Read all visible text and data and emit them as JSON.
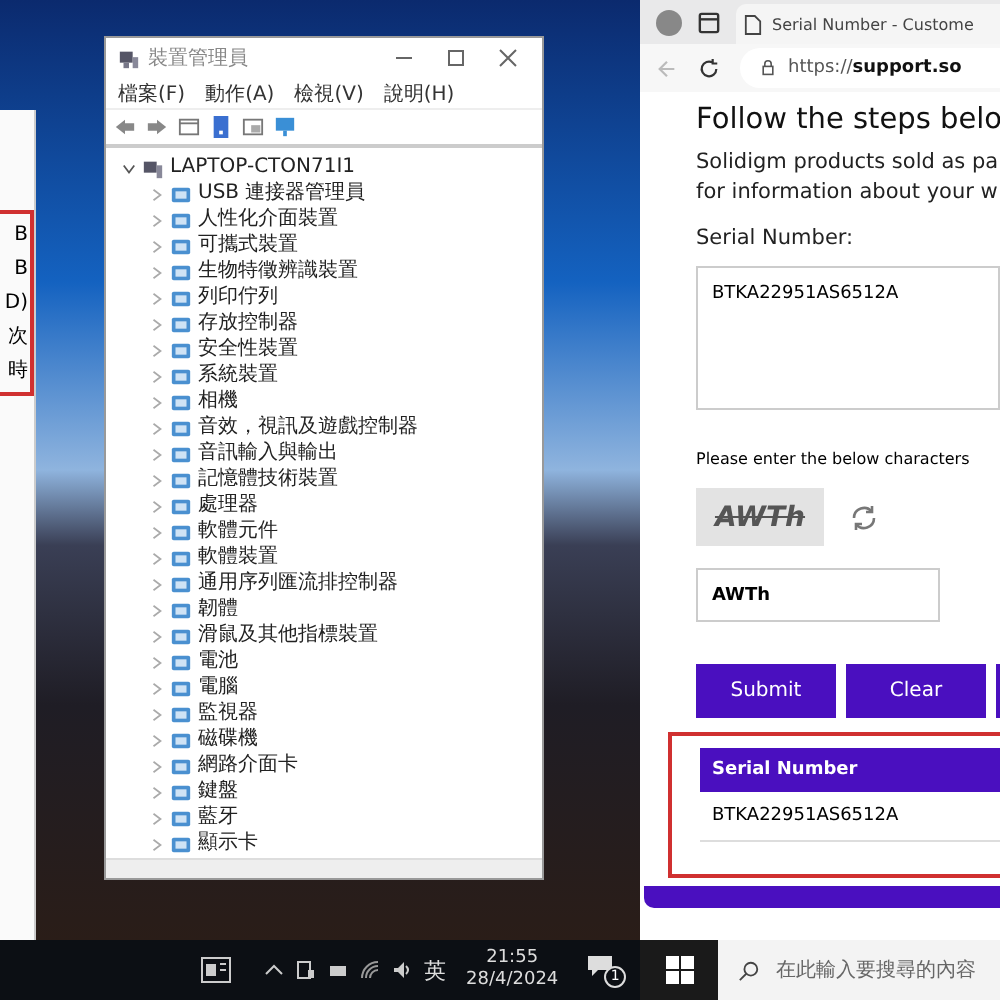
{
  "left_screen": {
    "background_window": {
      "highlighted_values": [
        "B",
        "B",
        "D)",
        "次",
        "時"
      ]
    },
    "device_manager": {
      "title": "裝置管理員",
      "menu": [
        "檔案(F)",
        "動作(A)",
        "檢視(V)",
        "說明(H)"
      ],
      "tree": {
        "label": "LAPTOP-CTON71I1",
        "expanded": true,
        "children": [
          {
            "label": "USB 連接器管理員",
            "expanded": false
          },
          {
            "label": "人性化介面裝置",
            "expanded": false
          },
          {
            "label": "可攜式裝置",
            "expanded": false
          },
          {
            "label": "生物特徵辨識裝置",
            "expanded": false
          },
          {
            "label": "列印佇列",
            "expanded": false
          },
          {
            "label": "存放控制器",
            "expanded": false
          },
          {
            "label": "安全性裝置",
            "expanded": false
          },
          {
            "label": "系統裝置",
            "expanded": false
          },
          {
            "label": "相機",
            "expanded": false
          },
          {
            "label": "音效，視訊及遊戲控制器",
            "expanded": false
          },
          {
            "label": "音訊輸入與輸出",
            "expanded": false
          },
          {
            "label": "記憶體技術裝置",
            "expanded": false
          },
          {
            "label": "處理器",
            "expanded": false
          },
          {
            "label": "軟體元件",
            "expanded": false
          },
          {
            "label": "軟體裝置",
            "expanded": false
          },
          {
            "label": "通用序列匯流排控制器",
            "expanded": false
          },
          {
            "label": "韌體",
            "expanded": false
          },
          {
            "label": "滑鼠及其他指標裝置",
            "expanded": false
          },
          {
            "label": "電池",
            "expanded": false
          },
          {
            "label": "電腦",
            "expanded": false
          },
          {
            "label": "監視器",
            "expanded": false
          },
          {
            "label": "磁碟機",
            "expanded": false
          },
          {
            "label": "網路介面卡",
            "expanded": false
          },
          {
            "label": "鍵盤",
            "expanded": false
          },
          {
            "label": "藍牙",
            "expanded": false
          },
          {
            "label": "顯示卡",
            "expanded": false
          }
        ]
      }
    },
    "taskbar": {
      "input_indicator": "英",
      "time": "21:55",
      "date": "28/4/2024",
      "notification_count": "1"
    }
  },
  "right_screen": {
    "browser": {
      "tab_title": "Serial Number - Custome",
      "url": "https://**support.so**"
    },
    "page": {
      "heading": "Follow the steps belo",
      "intro_lines": [
        "Solidigm products sold as pa",
        "for information about your w"
      ],
      "serial_label": "Serial Number:",
      "serial_value": "BTKA22951AS6512A",
      "captcha_prompt": "Please enter the below characters",
      "captcha_text": "AWTh",
      "captcha_value": "AWTh",
      "buttons": [
        {
          "kind": "full",
          "label": "Submit"
        },
        {
          "kind": "full",
          "label": "Clear"
        },
        {
          "kind": "cut_off"
        }
      ],
      "result_table": {
        "columns": [
          "Serial Number"
        ],
        "rows": [
          [
            "BTKA22951AS6512A"
          ]
        ]
      }
    },
    "taskbar": {
      "search_placeholder": "在此輸入要搜尋的內容"
    }
  }
}
